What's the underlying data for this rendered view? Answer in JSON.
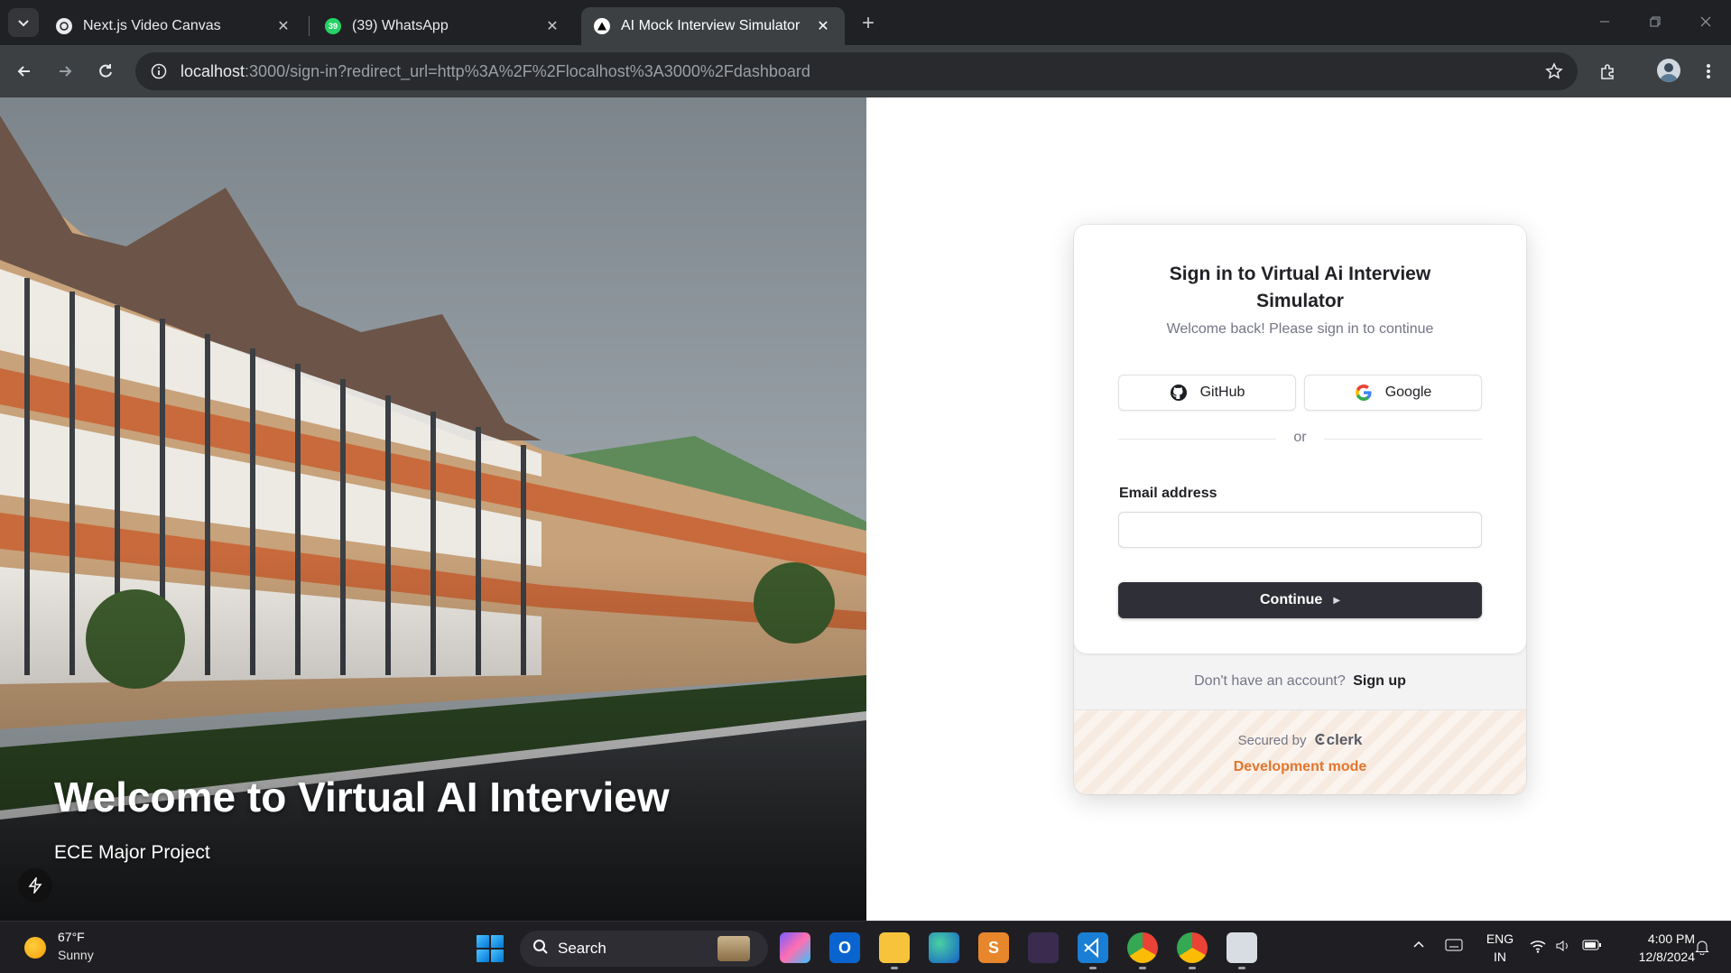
{
  "browser": {
    "tabs": [
      {
        "title": "Next.js Video Canvas",
        "active": false
      },
      {
        "title": "(39) WhatsApp",
        "active": false,
        "badge": "39"
      },
      {
        "title": "AI Mock Interview Simulator",
        "active": true
      }
    ],
    "url_host": "localhost",
    "url_rest": ":3000/sign-in?redirect_url=http%3A%2F%2Flocalhost%3A3000%2Fdashboard"
  },
  "hero": {
    "title": "Welcome to Virtual AI Interview",
    "subtitle": "ECE Major Project"
  },
  "signin": {
    "title": "Sign in to Virtual Ai Interview Simulator",
    "subtitle": "Welcome back! Please sign in to continue",
    "github_label": "GitHub",
    "google_label": "Google",
    "divider_text": "or",
    "email_label": "Email address",
    "email_value": "",
    "continue_label": "Continue",
    "no_account_text": "Don't have an account?",
    "signup_link": "Sign up",
    "secured_by": "Secured by",
    "brand": "clerk",
    "dev_mode": "Development mode"
  },
  "taskbar": {
    "weather_temp": "67°F",
    "weather_desc": "Sunny",
    "search_label": "Search",
    "lang_top": "ENG",
    "lang_bottom": "IN",
    "time": "4:00 PM",
    "date": "12/8/2024"
  },
  "colors": {
    "chrome_bg": "#202124",
    "toolbar_bg": "#3c4043",
    "button_dark": "#2f3037",
    "dev_mode_orange": "#e4742b",
    "taskbar_bg": "#1f1f23"
  }
}
